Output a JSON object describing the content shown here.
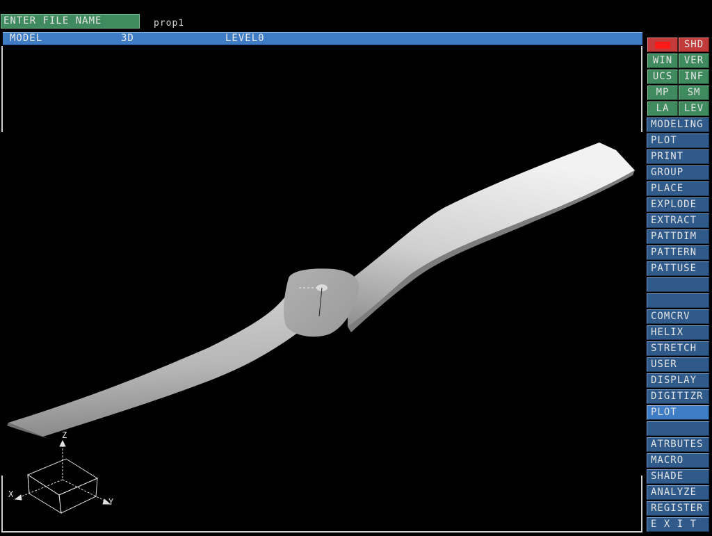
{
  "prompt": {
    "label": "ENTER FILE NAME",
    "value": "prop1"
  },
  "status": {
    "mode": "MODEL",
    "view": "3D",
    "level": "LEVEL0"
  },
  "toggles": [
    {
      "left": "",
      "right": "SHD"
    },
    {
      "left": "WIN",
      "right": "VER"
    },
    {
      "left": "UCS",
      "right": "INF"
    },
    {
      "left": "MP",
      "right": "SM"
    },
    {
      "left": "LA",
      "right": "LEV"
    }
  ],
  "menu": [
    "MODELING",
    "PLOT",
    "PRINT",
    "GROUP",
    "PLACE",
    "EXPLODE",
    "EXTRACT",
    "PATTDIM",
    "PATTERN",
    "PATTUSE",
    "",
    "",
    "COMCRV",
    "HELIX",
    "STRETCH",
    "USER",
    "DISPLAY",
    "DIGITIZR",
    "PLOT",
    "",
    "ATRBUTES",
    "MACRO",
    "SHADE",
    "ANALYZE",
    "REGISTER",
    "E X I T"
  ],
  "active_menu_item": "PLOT",
  "axes": {
    "x": "X",
    "y": "Y",
    "z": "Z"
  },
  "colors": {
    "status_bar": "#3e7dc6",
    "prompt": "#3f8a5e",
    "toggle": "#3f8a5e",
    "menu": "#2f5a8a",
    "menu_active": "#3e7dc6",
    "shd_swatch": "#ff1a1a"
  }
}
